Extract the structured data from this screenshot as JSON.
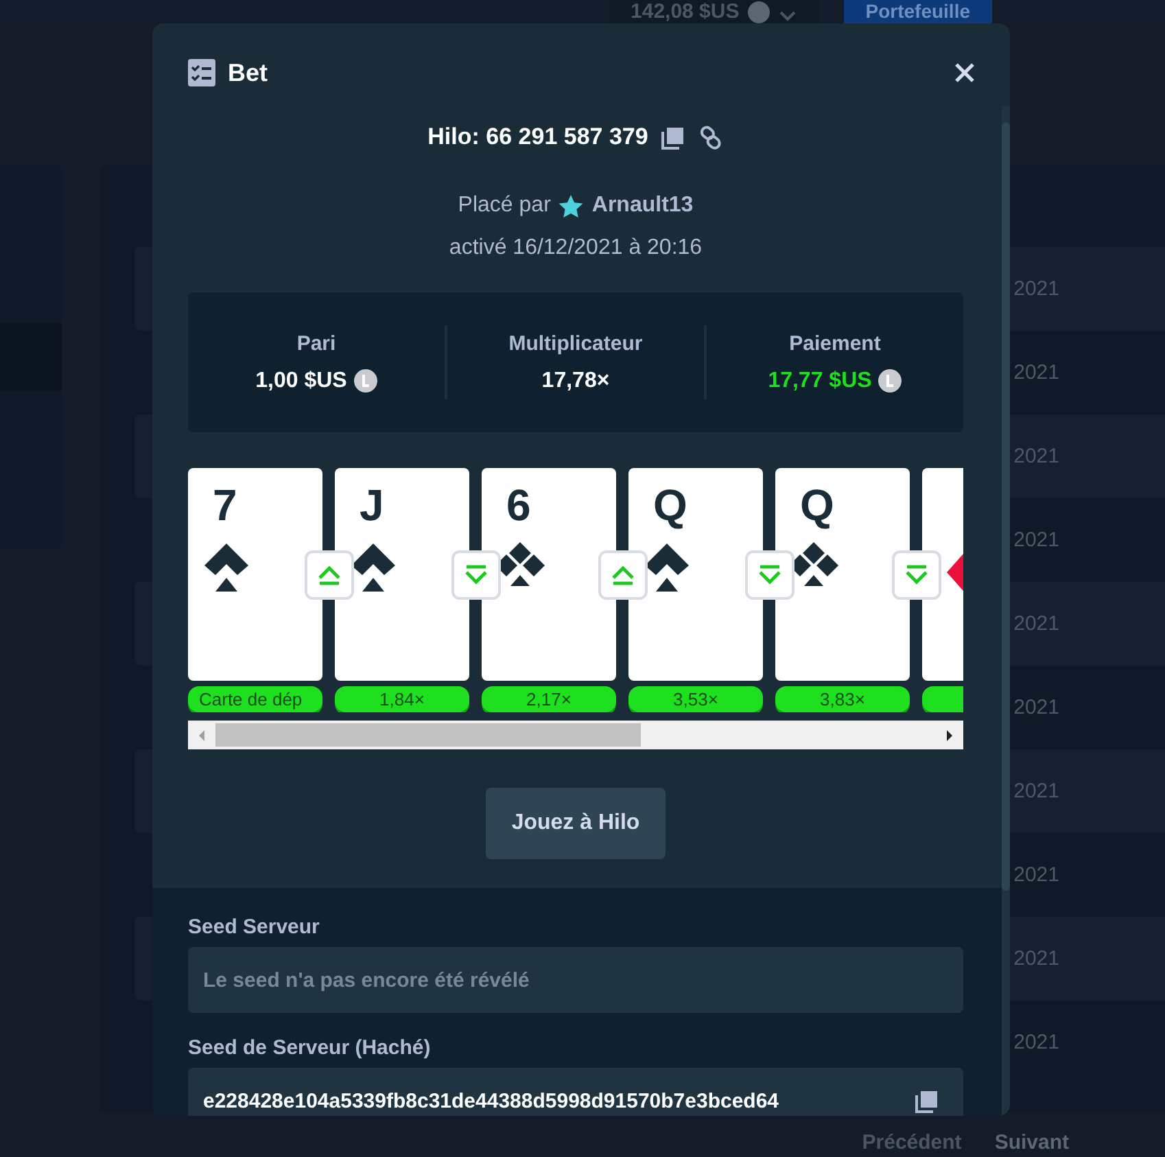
{
  "background": {
    "balance": "142,08 $US",
    "wallet_button": "Portefeuille",
    "table_cells": [
      "2021",
      "2021",
      "2021",
      "2021",
      "2021",
      "2021",
      "2021",
      "2021",
      "2021",
      "2021"
    ],
    "pagination": [
      {
        "label": "Précédent",
        "disabled": true
      },
      {
        "label": "Suivant",
        "disabled": false
      }
    ]
  },
  "modal": {
    "title": "Bet",
    "game_id": "Hilo: 66 291 587 379",
    "placed_by_label": "Placé par",
    "player": "Arnault13",
    "activated": "activé 16/12/2021 à 20:16",
    "stats": [
      {
        "label": "Pari",
        "value": "1,00 $US",
        "kind": "amount"
      },
      {
        "label": "Multiplicateur",
        "value": "17,78×",
        "kind": "multiplier"
      },
      {
        "label": "Paiement",
        "value": "17,77 $US",
        "kind": "payout"
      }
    ],
    "cards": [
      {
        "rank": "7",
        "kind": "spade",
        "higher": true,
        "multiplier": "Carte de dép"
      },
      {
        "rank": "J",
        "kind": "spade",
        "higher": false,
        "multiplier": "1,84×"
      },
      {
        "rank": "6",
        "kind": "club",
        "higher": true,
        "multiplier": "2,17×"
      },
      {
        "rank": "Q",
        "kind": "spade",
        "higher": false,
        "multiplier": "3,53×"
      },
      {
        "rank": "Q",
        "kind": "club",
        "higher": false,
        "multiplier": "3,83×"
      },
      {
        "kind": "diamond"
      }
    ],
    "play_button": "Jouez à Hilo",
    "fields": [
      {
        "label": "Seed Serveur",
        "placeholder": "Le seed n'a pas encore été révélé"
      },
      {
        "label": "Seed de Serveur (Haché)",
        "value": "e228428e104a5339fb8c31de44388d5998d91570b7e3bced64",
        "copyable": true
      }
    ]
  }
}
